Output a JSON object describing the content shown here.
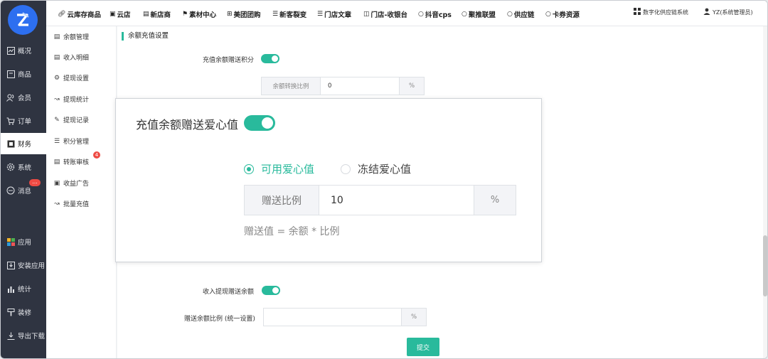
{
  "sidebar": {
    "items": [
      {
        "label": "概况",
        "icon": "chart-icon"
      },
      {
        "label": "商品",
        "icon": "box-icon"
      },
      {
        "label": "会员",
        "icon": "users-icon"
      },
      {
        "label": "订单",
        "icon": "cart-icon"
      },
      {
        "label": "财务",
        "icon": "ledger-icon"
      },
      {
        "label": "系统",
        "icon": "gear-icon"
      },
      {
        "label": "消息",
        "icon": "message-icon"
      },
      {
        "label": "应用",
        "icon": "apps-icon"
      },
      {
        "label": "安装应用",
        "icon": "install-icon"
      },
      {
        "label": "统计",
        "icon": "bar-chart-icon"
      },
      {
        "label": "装修",
        "icon": "brush-icon"
      },
      {
        "label": "导出下载",
        "icon": "download-icon"
      }
    ],
    "message_badge": "..."
  },
  "topbar": {
    "links": [
      "云库存商品",
      "云店",
      "新店商",
      "素材中心",
      "美团团购",
      "新客裂变",
      "门店文章",
      "门店-收银台",
      "抖音cps",
      "聚推联盟",
      "供应链",
      "卡券资源"
    ],
    "system_name": "数字化供应链系统",
    "user": "YZ(系统管理员)"
  },
  "submenu": {
    "items": [
      "余额管理",
      "收入明细",
      "提现设置",
      "提现统计",
      "提现记录",
      "积分管理",
      "转账审核",
      "收益广告",
      "批量充值"
    ],
    "badge": "4"
  },
  "main": {
    "section_title": "余额充值设置",
    "field1_label": "充值余额赠送积分",
    "field1_addon": "余额转换比例",
    "field1_value": "0",
    "field1_unit": "%",
    "field2_label": "收入提现赠送余额",
    "field3_label": "赠送余额比例 (统一设置)",
    "field3_unit": "%",
    "submit": "提交"
  },
  "popup": {
    "label": "充值余额赠送爱心值",
    "radio_available": "可用爱心值",
    "radio_frozen": "冻结爱心值",
    "ratio_label": "赠送比例",
    "ratio_value": "10",
    "ratio_unit": "%",
    "hint": "赠送值 = 余额 * 比例"
  },
  "colors": {
    "accent": "#29ba9c",
    "sidebar": "#2f3441",
    "badge": "#ee4b44"
  }
}
